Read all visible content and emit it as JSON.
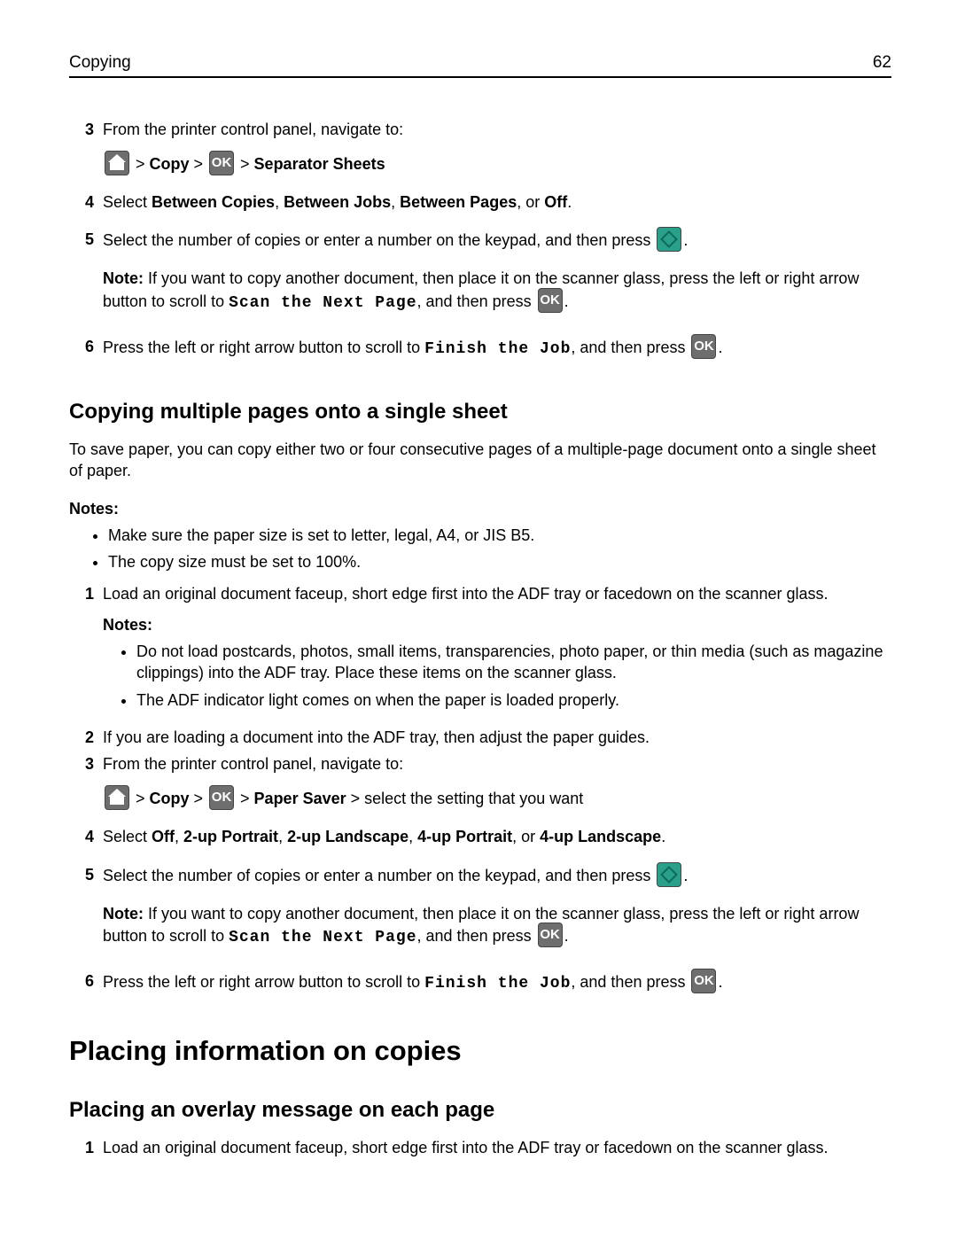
{
  "header": {
    "title": "Copying",
    "page": "62"
  },
  "s1": {
    "n3": "3",
    "t3": "From the printer control panel, navigate to:",
    "path3": {
      "gt": " > ",
      "copy": "Copy",
      "item": "Separator Sheets"
    },
    "n4": "4",
    "t4_a": "Select ",
    "t4_bc": "Between Copies",
    "t4_c": ", ",
    "t4_bj": "Between Jobs",
    "t4_c2": ", ",
    "t4_bp": "Between Pages",
    "t4_c3": ", or ",
    "t4_off": "Off",
    "t4_p": ".",
    "n5": "5",
    "t5": "Select the number of copies or enter a number on the keypad, and then press ",
    "note5a": "Note: ",
    "note5b": "If you want to copy another document, then place it on the scanner glass, press the left or right arrow button to scroll to ",
    "scan_next": "Scan the Next Page",
    "note5c": ", and then press ",
    "n6": "6",
    "t6a": "Press the left or right arrow button to scroll to ",
    "finish": "Finish the Job",
    "t6b": ", and then press "
  },
  "h2a": "Copying multiple pages onto a single sheet",
  "intro2": "To save paper, you can copy either two or four consecutive pages of a multiple‑page document onto a single sheet of paper.",
  "notesLabel": "Notes:",
  "bul1": "Make sure the paper size is set to letter, legal, A4, or JIS B5.",
  "bul2": "The copy size must be set to 100%.",
  "s2": {
    "n1": "1",
    "t1": "Load an original document faceup, short edge first into the ADF tray or facedown on the scanner glass.",
    "innerNotes": "Notes:",
    "ib1": "Do not load postcards, photos, small items, transparencies, photo paper, or thin media (such as magazine clippings) into the ADF tray. Place these items on the scanner glass.",
    "ib2": "The ADF indicator light comes on when the paper is loaded properly.",
    "n2": "2",
    "t2": "If you are loading a document into the ADF tray, then adjust the paper guides.",
    "n3": "3",
    "t3": "From the printer control panel, navigate to:",
    "path3": {
      "gt": " > ",
      "copy": "Copy",
      "ps": "Paper Saver",
      "tail": " > select the setting that you want"
    },
    "n4": "4",
    "t4_a": "Select ",
    "off": "Off",
    "c1": ", ",
    "p2p": "2‑up Portrait",
    "c2": ", ",
    "l2": "2‑up Landscape",
    "c3": ", ",
    "p4": "4‑up Portrait",
    "c4": ", or ",
    "l4": "4‑up Landscape",
    "p": ".",
    "n5": "5",
    "t5": "Select the number of copies or enter a number on the keypad, and then press ",
    "note5a": "Note: ",
    "note5b": "If you want to copy another document, then place it on the scanner glass, press the left or right arrow button to scroll to ",
    "scan_next": "Scan the Next Page",
    "note5c": ", and then press ",
    "n6": "6",
    "t6a": "Press the left or right arrow button to scroll to ",
    "finish": "Finish the Job",
    "t6b": ", and then press "
  },
  "h1": "Placing information on copies",
  "h2b": "Placing an overlay message on each page",
  "s3": {
    "n1": "1",
    "t1": "Load an original document faceup, short edge first into the ADF tray or facedown on the scanner glass."
  },
  "ok": "OK",
  "dot": "."
}
